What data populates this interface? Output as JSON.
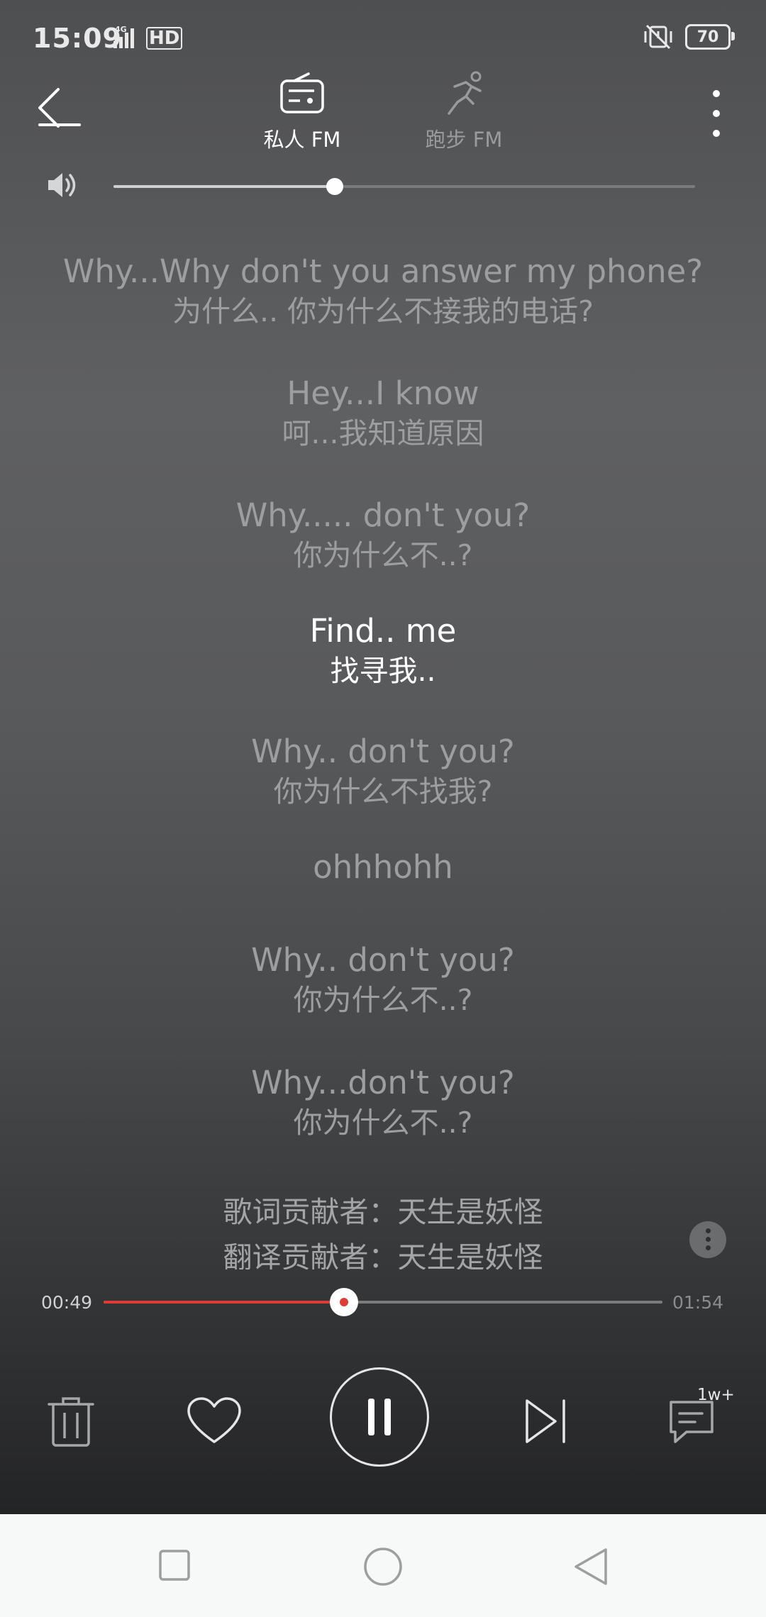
{
  "status_bar": {
    "time": "15:09",
    "network": "4G",
    "hd": "HD",
    "battery": "70"
  },
  "header": {
    "tabs": [
      {
        "label": "私人 FM",
        "icon": "radio-icon",
        "active": true
      },
      {
        "label": "跑步 FM",
        "icon": "running-icon",
        "active": false
      }
    ]
  },
  "volume": {
    "level": 0.38
  },
  "lyrics": [
    {
      "en": "Why...Why don't you answer my phone?",
      "zh": "为什么.. 你为什么不接我的电话?"
    },
    {
      "en": "Hey...I know",
      "zh": "呵...我知道原因"
    },
    {
      "en": "Why..... don't you?",
      "zh": "你为什么不..?"
    },
    {
      "en": "Find.. me",
      "zh": "找寻我..",
      "active": true
    },
    {
      "en": "Why.. don't you?",
      "zh": "你为什么不找我?"
    },
    {
      "en": "ohhhohh"
    },
    {
      "en": "Why.. don't you?",
      "zh": "你为什么不..?"
    },
    {
      "en": "Why...don't you?",
      "zh": "你为什么不..?"
    }
  ],
  "credits": {
    "lyrics_contributor": "歌词贡献者：天生是妖怪",
    "translation_contributor": "翻译贡献者：天生是妖怪"
  },
  "playback": {
    "current_time": "00:49",
    "total_time": "01:54",
    "progress": 0.43
  },
  "controls": {
    "comment_count": "1w+"
  },
  "colors": {
    "accent": "#e03c33",
    "active_lyric": "#ffffff",
    "inactive_lyric": "#9d9e9f"
  }
}
